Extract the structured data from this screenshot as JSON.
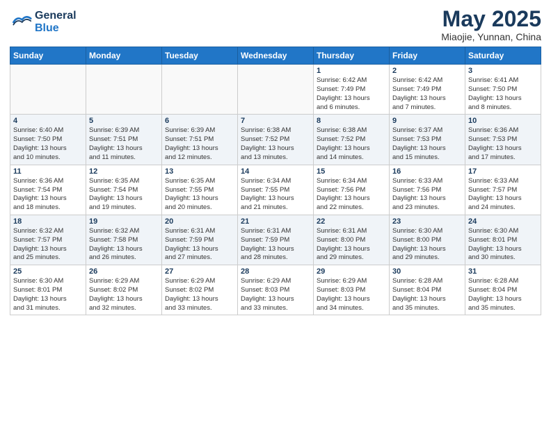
{
  "header": {
    "logo_general": "General",
    "logo_blue": "Blue",
    "month_title": "May 2025",
    "location": "Miaojie, Yunnan, China"
  },
  "weekdays": [
    "Sunday",
    "Monday",
    "Tuesday",
    "Wednesday",
    "Thursday",
    "Friday",
    "Saturday"
  ],
  "weeks": [
    [
      {
        "day": "",
        "content": ""
      },
      {
        "day": "",
        "content": ""
      },
      {
        "day": "",
        "content": ""
      },
      {
        "day": "",
        "content": ""
      },
      {
        "day": "1",
        "content": "Sunrise: 6:42 AM\nSunset: 7:49 PM\nDaylight: 13 hours\nand 6 minutes."
      },
      {
        "day": "2",
        "content": "Sunrise: 6:42 AM\nSunset: 7:49 PM\nDaylight: 13 hours\nand 7 minutes."
      },
      {
        "day": "3",
        "content": "Sunrise: 6:41 AM\nSunset: 7:50 PM\nDaylight: 13 hours\nand 8 minutes."
      }
    ],
    [
      {
        "day": "4",
        "content": "Sunrise: 6:40 AM\nSunset: 7:50 PM\nDaylight: 13 hours\nand 10 minutes."
      },
      {
        "day": "5",
        "content": "Sunrise: 6:39 AM\nSunset: 7:51 PM\nDaylight: 13 hours\nand 11 minutes."
      },
      {
        "day": "6",
        "content": "Sunrise: 6:39 AM\nSunset: 7:51 PM\nDaylight: 13 hours\nand 12 minutes."
      },
      {
        "day": "7",
        "content": "Sunrise: 6:38 AM\nSunset: 7:52 PM\nDaylight: 13 hours\nand 13 minutes."
      },
      {
        "day": "8",
        "content": "Sunrise: 6:38 AM\nSunset: 7:52 PM\nDaylight: 13 hours\nand 14 minutes."
      },
      {
        "day": "9",
        "content": "Sunrise: 6:37 AM\nSunset: 7:53 PM\nDaylight: 13 hours\nand 15 minutes."
      },
      {
        "day": "10",
        "content": "Sunrise: 6:36 AM\nSunset: 7:53 PM\nDaylight: 13 hours\nand 17 minutes."
      }
    ],
    [
      {
        "day": "11",
        "content": "Sunrise: 6:36 AM\nSunset: 7:54 PM\nDaylight: 13 hours\nand 18 minutes."
      },
      {
        "day": "12",
        "content": "Sunrise: 6:35 AM\nSunset: 7:54 PM\nDaylight: 13 hours\nand 19 minutes."
      },
      {
        "day": "13",
        "content": "Sunrise: 6:35 AM\nSunset: 7:55 PM\nDaylight: 13 hours\nand 20 minutes."
      },
      {
        "day": "14",
        "content": "Sunrise: 6:34 AM\nSunset: 7:55 PM\nDaylight: 13 hours\nand 21 minutes."
      },
      {
        "day": "15",
        "content": "Sunrise: 6:34 AM\nSunset: 7:56 PM\nDaylight: 13 hours\nand 22 minutes."
      },
      {
        "day": "16",
        "content": "Sunrise: 6:33 AM\nSunset: 7:56 PM\nDaylight: 13 hours\nand 23 minutes."
      },
      {
        "day": "17",
        "content": "Sunrise: 6:33 AM\nSunset: 7:57 PM\nDaylight: 13 hours\nand 24 minutes."
      }
    ],
    [
      {
        "day": "18",
        "content": "Sunrise: 6:32 AM\nSunset: 7:57 PM\nDaylight: 13 hours\nand 25 minutes."
      },
      {
        "day": "19",
        "content": "Sunrise: 6:32 AM\nSunset: 7:58 PM\nDaylight: 13 hours\nand 26 minutes."
      },
      {
        "day": "20",
        "content": "Sunrise: 6:31 AM\nSunset: 7:59 PM\nDaylight: 13 hours\nand 27 minutes."
      },
      {
        "day": "21",
        "content": "Sunrise: 6:31 AM\nSunset: 7:59 PM\nDaylight: 13 hours\nand 28 minutes."
      },
      {
        "day": "22",
        "content": "Sunrise: 6:31 AM\nSunset: 8:00 PM\nDaylight: 13 hours\nand 29 minutes."
      },
      {
        "day": "23",
        "content": "Sunrise: 6:30 AM\nSunset: 8:00 PM\nDaylight: 13 hours\nand 29 minutes."
      },
      {
        "day": "24",
        "content": "Sunrise: 6:30 AM\nSunset: 8:01 PM\nDaylight: 13 hours\nand 30 minutes."
      }
    ],
    [
      {
        "day": "25",
        "content": "Sunrise: 6:30 AM\nSunset: 8:01 PM\nDaylight: 13 hours\nand 31 minutes."
      },
      {
        "day": "26",
        "content": "Sunrise: 6:29 AM\nSunset: 8:02 PM\nDaylight: 13 hours\nand 32 minutes."
      },
      {
        "day": "27",
        "content": "Sunrise: 6:29 AM\nSunset: 8:02 PM\nDaylight: 13 hours\nand 33 minutes."
      },
      {
        "day": "28",
        "content": "Sunrise: 6:29 AM\nSunset: 8:03 PM\nDaylight: 13 hours\nand 33 minutes."
      },
      {
        "day": "29",
        "content": "Sunrise: 6:29 AM\nSunset: 8:03 PM\nDaylight: 13 hours\nand 34 minutes."
      },
      {
        "day": "30",
        "content": "Sunrise: 6:28 AM\nSunset: 8:04 PM\nDaylight: 13 hours\nand 35 minutes."
      },
      {
        "day": "31",
        "content": "Sunrise: 6:28 AM\nSunset: 8:04 PM\nDaylight: 13 hours\nand 35 minutes."
      }
    ]
  ]
}
